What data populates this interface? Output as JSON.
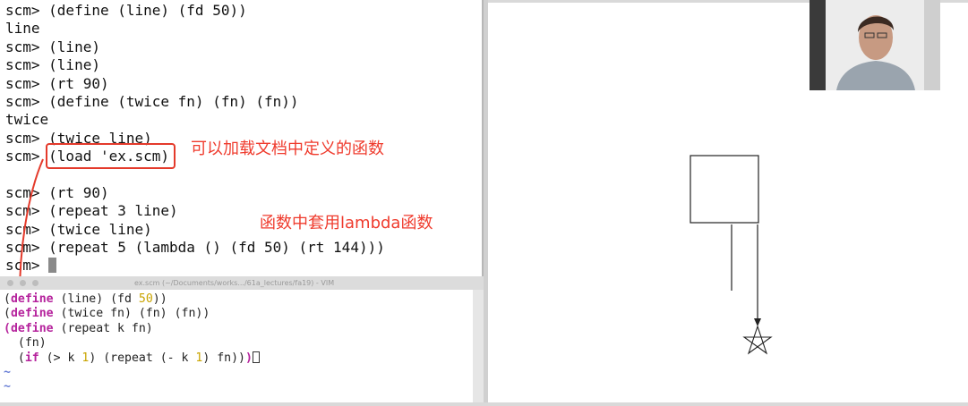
{
  "terminal": {
    "prompt": "scm>",
    "lines": [
      "scm> (define (line) (fd 50))",
      "line",
      "scm> (line)",
      "scm> (line)",
      "scm> (rt 90)",
      "scm> (define (twice fn) (fn) (fn))",
      "twice",
      "scm> (twice line)",
      "scm> (load 'ex.scm)",
      "",
      "scm> (rt 90)",
      "scm> (repeat 3 line)",
      "scm> (twice line)",
      "scm> (repeat 5 (lambda () (fd 50) (rt 144)))",
      "scm> "
    ]
  },
  "annotations": {
    "load_note": "可以加载文档中定义的函数",
    "lambda_note": "函数中套用lambda函数",
    "highlight_color": "#e43a2b"
  },
  "vim": {
    "title": "ex.scm (~/Documents/works.../61a_lectures/fa19) - VIM",
    "code": {
      "l1": {
        "kw": "define",
        "a": " (line) (fd ",
        "n": "50",
        "b": "))"
      },
      "l2": {
        "kw": "define",
        "a": " (twice fn) (fn) (fn))"
      },
      "l3": {
        "kw": "define",
        "a": " (repeat k fn)"
      },
      "l4": {
        "a": "  (fn)"
      },
      "l5": {
        "kw": "if",
        "a1": " (> k ",
        "n1": "1",
        "a2": ") (repeat (- k ",
        "n2": "1",
        "a3": ") fn))",
        "close": ")"
      }
    },
    "tilde": "~",
    "keyword_color": "#b5229c",
    "number_color": "#c9a400"
  },
  "canvas": {
    "background": "#ffffff",
    "drawings": [
      "square",
      "line",
      "arrow",
      "star"
    ]
  },
  "webcam": {
    "subject": "presenter"
  }
}
